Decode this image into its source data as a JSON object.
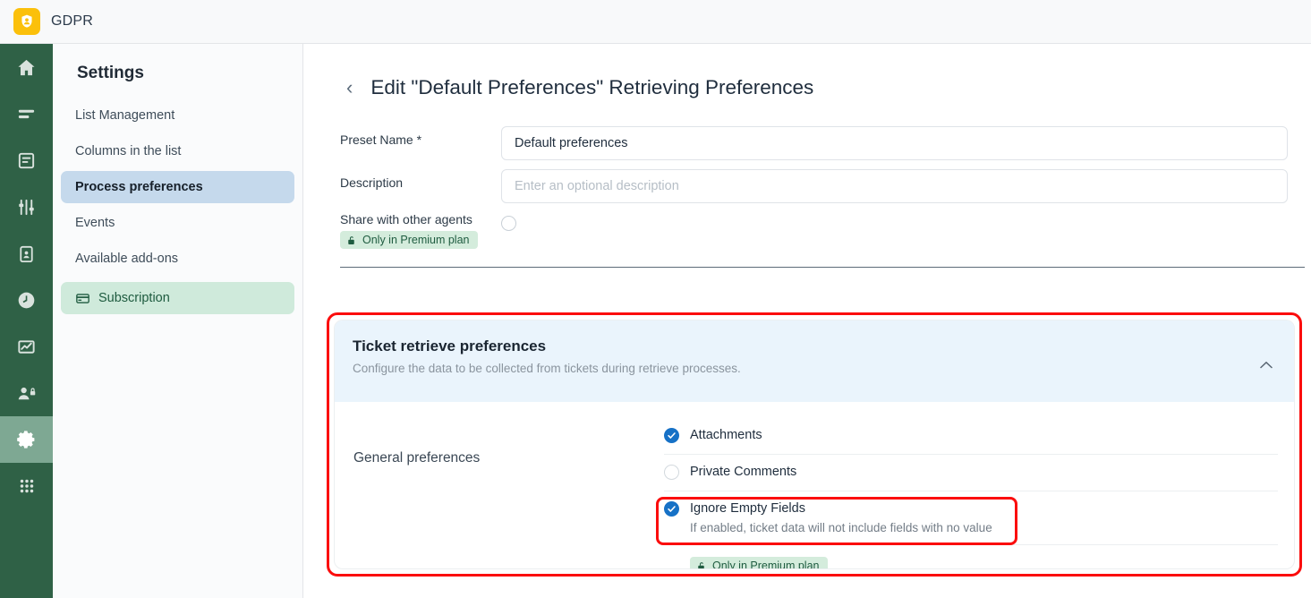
{
  "topbar": {
    "brand_name": "GDPR",
    "logo_icon": "shield-user-icon",
    "logo_color": "#fbc00b"
  },
  "rail": {
    "items": [
      {
        "icon": "home-icon",
        "active": false
      },
      {
        "icon": "list-icon",
        "active": false
      },
      {
        "icon": "database-icon",
        "active": false
      },
      {
        "icon": "sliders-icon",
        "active": false
      },
      {
        "icon": "clipboard-user-icon",
        "active": false
      },
      {
        "icon": "clock-icon",
        "active": false
      },
      {
        "icon": "chart-icon",
        "active": false
      },
      {
        "icon": "user-lock-icon",
        "active": false
      },
      {
        "icon": "gear-icon",
        "active": true
      },
      {
        "icon": "grid-apps-icon",
        "active": false
      }
    ],
    "background_color": "#2f6146",
    "active_color": "#7ea893"
  },
  "settings": {
    "title": "Settings",
    "items": [
      {
        "label": "List Management",
        "active": false,
        "icon": null
      },
      {
        "label": "Columns in the list",
        "active": false,
        "icon": null
      },
      {
        "label": "Process preferences",
        "active": true,
        "icon": null
      },
      {
        "label": "Events",
        "active": false,
        "icon": null
      },
      {
        "label": "Available add-ons",
        "active": false,
        "icon": null
      },
      {
        "label": "Subscription",
        "active": false,
        "icon": "credit-card-icon"
      }
    ],
    "active_color": "#c5d9ec",
    "subscription_color": "#cfeadb"
  },
  "page": {
    "back_icon": "chevron-left-icon",
    "title": "Edit \"Default Preferences\" Retrieving Preferences"
  },
  "form": {
    "preset_name": {
      "label": "Preset Name *",
      "value": "Default preferences",
      "placeholder": ""
    },
    "description": {
      "label": "Description",
      "value": "",
      "placeholder": "Enter an optional description"
    },
    "share": {
      "label": "Share with other agents",
      "checked": false,
      "badge": "Only in Premium plan",
      "badge_icon": "unlock-icon"
    }
  },
  "section": {
    "title": "Ticket retrieve preferences",
    "subtitle": "Configure the data to be collected from tickets during retrieve processes.",
    "collapse_icon": "chevron-up-icon",
    "group_label": "General preferences",
    "header_color": "#eaf4fc",
    "checkboxes": [
      {
        "label": "Attachments",
        "checked": true,
        "description": ""
      },
      {
        "label": "Private Comments",
        "checked": false,
        "description": ""
      },
      {
        "label": "Ignore Empty Fields",
        "checked": true,
        "description": "If enabled, ticket data will not include fields with no value"
      }
    ],
    "badge": "Only in Premium plan",
    "badge_icon": "unlock-icon"
  },
  "annotations": {
    "color": "#fb0d0d",
    "outer_label": "ticket-retrieve-preferences-highlight",
    "inner_label": "ignore-empty-fields-highlight"
  }
}
